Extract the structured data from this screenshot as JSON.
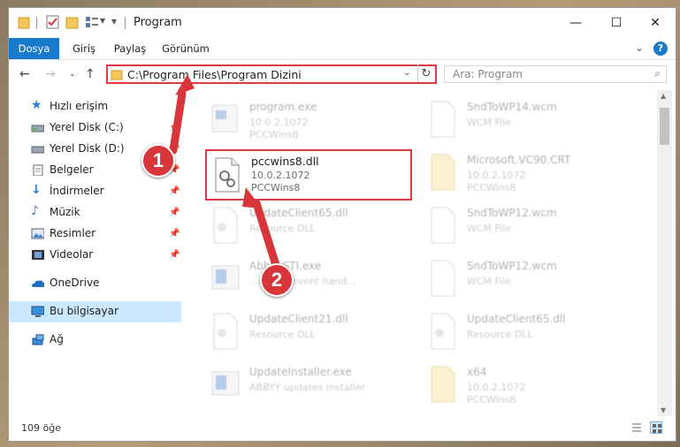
{
  "window": {
    "title": "Program",
    "controls": {
      "minimize": "—",
      "maximize": "☐",
      "close": "✕"
    }
  },
  "ribbon": {
    "tabs": [
      "Dosya",
      "Giriş",
      "Paylaş",
      "Görünüm"
    ],
    "expand_icon": "chevron-down-icon",
    "help_label": "?"
  },
  "navigation": {
    "address": "C:\\Program Files\\Program Dizini",
    "search_placeholder": "Ara: Program"
  },
  "sidebar": {
    "items": [
      {
        "label": "Hızlı erişim",
        "icon": "star-icon"
      },
      {
        "label": "Yerel Disk (C:)",
        "icon": "drive-icon",
        "pinned": true
      },
      {
        "label": "Yerel Disk (D:)",
        "icon": "drive-icon",
        "pinned": true
      },
      {
        "label": "Belgeler",
        "icon": "documents-icon",
        "pinned": true
      },
      {
        "label": "İndirmeler",
        "icon": "download-icon",
        "pinned": true
      },
      {
        "label": "Müzik",
        "icon": "music-icon",
        "pinned": true
      },
      {
        "label": "Resimler",
        "icon": "pictures-icon",
        "pinned": true
      },
      {
        "label": "Videolar",
        "icon": "videos-icon",
        "pinned": true
      },
      {
        "label": "OneDrive",
        "icon": "onedrive-icon"
      },
      {
        "label": "Bu bilgisayar",
        "icon": "computer-icon",
        "selected": true
      },
      {
        "label": "Ağ",
        "icon": "network-icon"
      }
    ]
  },
  "files": [
    {
      "name": "program.exe",
      "line2": "10.0.2.1072",
      "line3": "PCCWins8",
      "icon": "exe-icon"
    },
    {
      "name": "SndToWP14.wcm",
      "line2": "WCM File",
      "line3": "",
      "icon": "blank-file-icon"
    },
    {
      "name": "pccwins8.dll",
      "line2": "10.0.2.1072",
      "line3": "PCCWins8",
      "icon": "dll-icon",
      "highlighted": true
    },
    {
      "name": "Microsoft.VC90.CRT",
      "line2": "10.0.2.1072",
      "line3": "PCCWins8",
      "icon": "folder-file-icon"
    },
    {
      "name": "UpdateClient65.dll",
      "line2": "Resource DLL",
      "line3": "",
      "icon": "dll-icon"
    },
    {
      "name": "SndToWP12.wcm",
      "line2": "WCM File",
      "line3": "",
      "icon": "blank-file-icon"
    },
    {
      "name": "AbbyySTI.exe",
      "line2": "...abbyy event hand...",
      "line3": "",
      "icon": "exe-icon"
    },
    {
      "name": "SndToWP12.wcm",
      "line2": "WCM File",
      "line3": "",
      "icon": "blank-file-icon"
    },
    {
      "name": "UpdateClient21.dll",
      "line2": "Resource DLL",
      "line3": "",
      "icon": "dll-icon"
    },
    {
      "name": "UpdateClient65.dll",
      "line2": "Resource DLL",
      "line3": "",
      "icon": "dll-icon"
    },
    {
      "name": "UpdateInstaller.exe",
      "line2": "ABBYY updates installer",
      "line3": "",
      "icon": "exe-icon"
    },
    {
      "name": "x64",
      "line2": "10.0.2.1072",
      "line3": "PCCWins8",
      "icon": "folder-file-icon"
    }
  ],
  "status": {
    "count": "109 öğe"
  },
  "callouts": [
    "1",
    "2"
  ],
  "colors": {
    "accent": "#1979ca",
    "highlight": "#e0393e",
    "badge": "#d9363b"
  }
}
